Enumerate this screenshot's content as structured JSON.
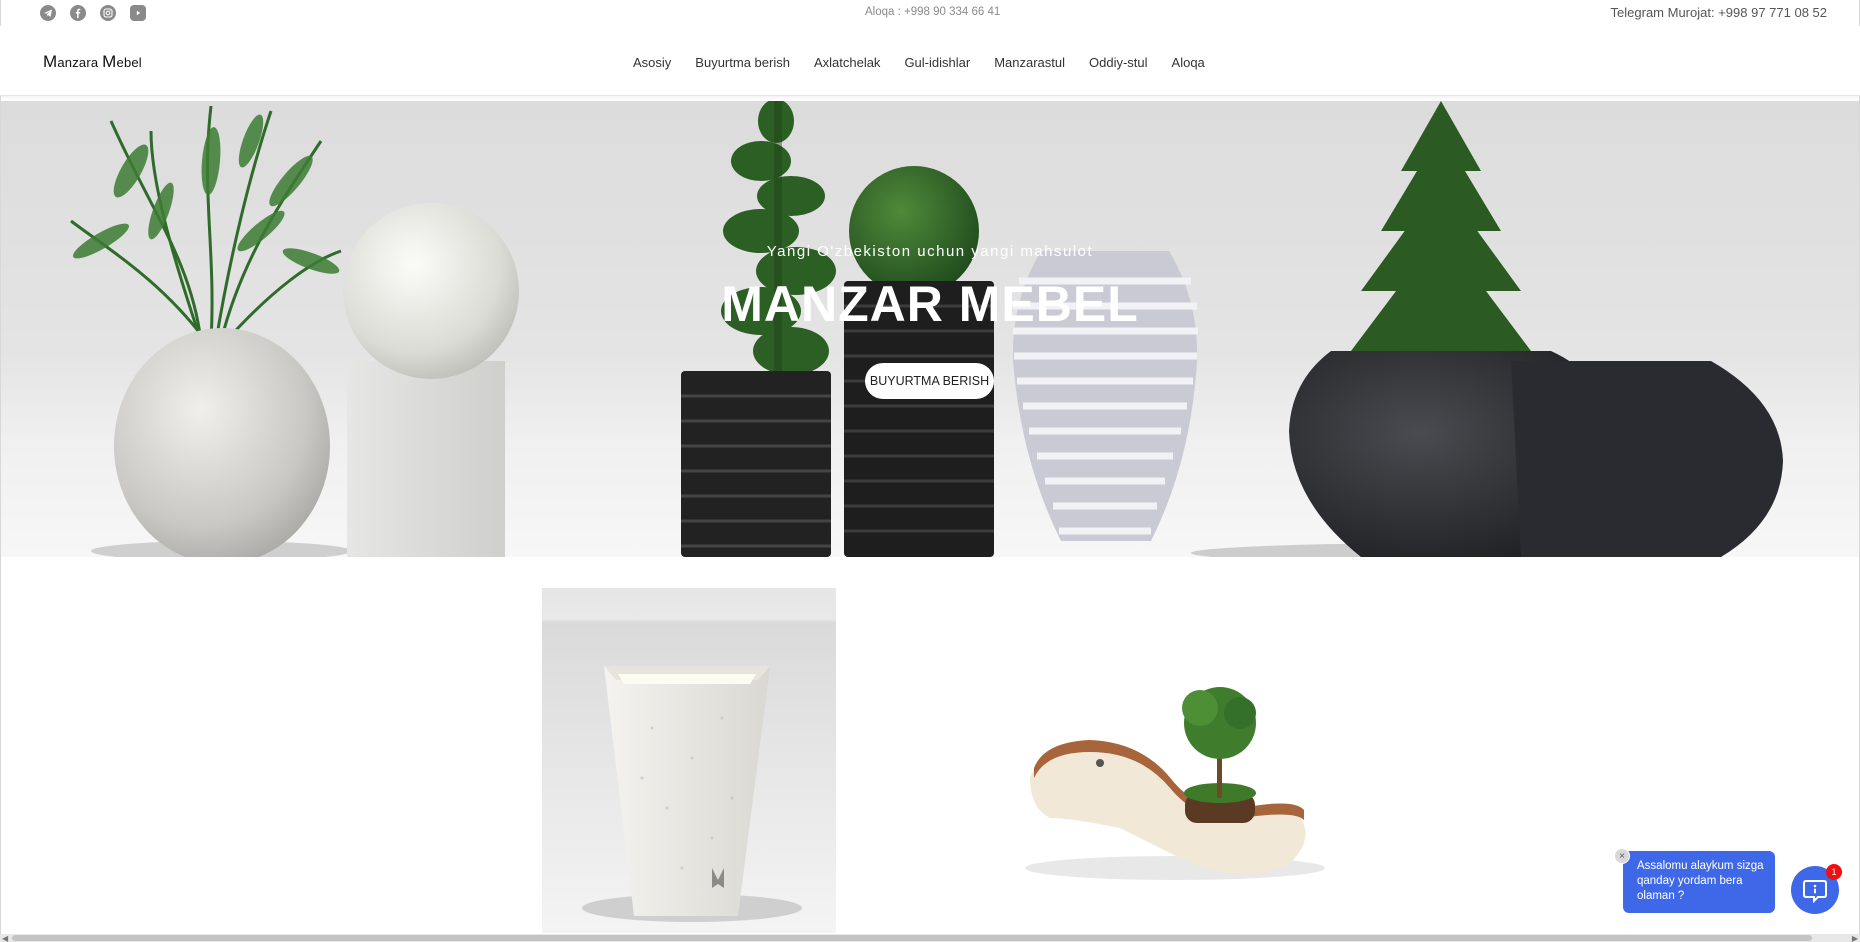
{
  "topbar": {
    "socials": [
      {
        "icon": "telegram-icon"
      },
      {
        "icon": "facebook-icon"
      },
      {
        "icon": "instagram-icon"
      },
      {
        "icon": "youtube-icon"
      }
    ],
    "contact": "Aloqa : +998 90 334 66 41",
    "telegram": "Telegram Murojat: +998 97 771 08 52"
  },
  "header": {
    "logo_first_cap": "M",
    "logo_first_rest": "anzara ",
    "logo_second_cap": "M",
    "logo_second_rest": "ebel",
    "nav": [
      "Asosiy",
      "Buyurtma berish",
      "Axlatchelak",
      "Gul-idishlar",
      "Manzarastul",
      "Oddiy-stul",
      "Aloqa"
    ]
  },
  "hero": {
    "subtitle": "Yangi O'zbekiston uchun yangi mahsulot",
    "title": "MANZAR MEBEL",
    "button": "BUYURTMA BERISH"
  },
  "chat": {
    "message": "Assalomu alaykum sizga qanday yordam bera olaman ?",
    "close_icon": "×",
    "badge_count": "1"
  },
  "colors": {
    "accent": "#3f68e8",
    "badge": "#e11111"
  }
}
